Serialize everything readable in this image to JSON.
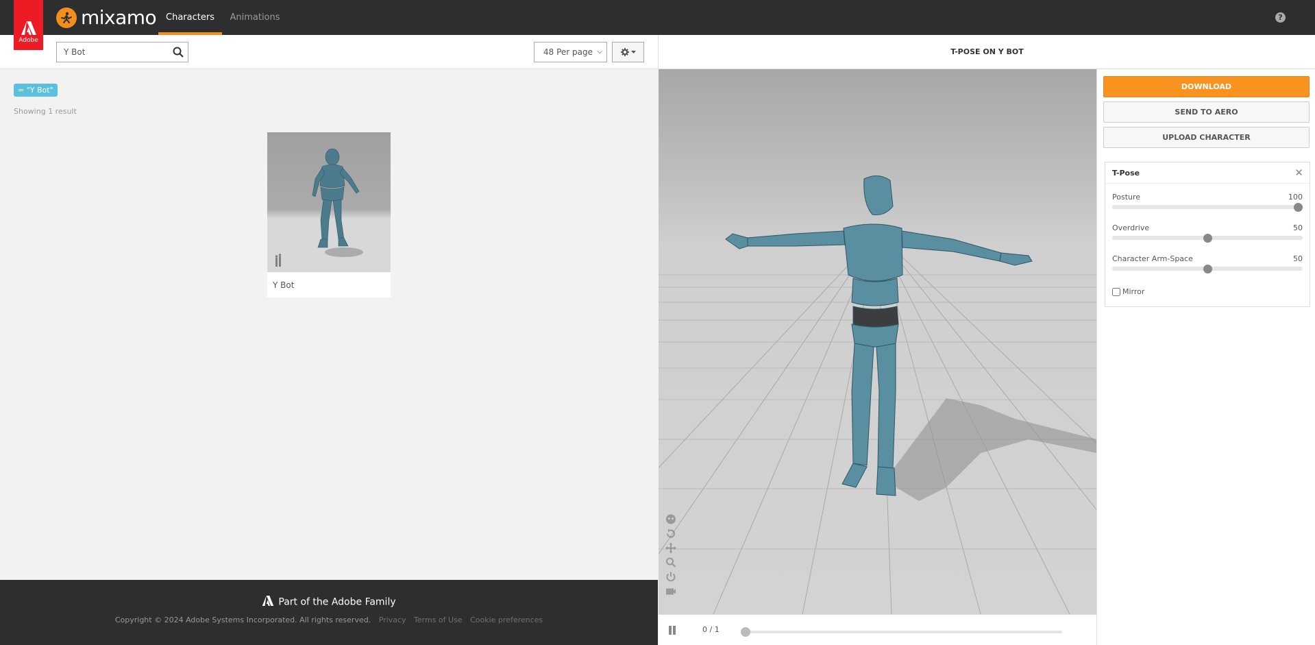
{
  "brand": {
    "adobe_label": "Adobe",
    "app_name": "mixamo",
    "accent": "#f38d1c"
  },
  "nav": {
    "tabs": [
      {
        "label": "Characters",
        "active": true
      },
      {
        "label": "Animations",
        "active": false
      }
    ],
    "help": "?"
  },
  "search": {
    "value": "Y Bot"
  },
  "toolbar": {
    "per_page": "48 Per page"
  },
  "results": {
    "filter_tag": "= \"Y Bot\"",
    "count_text": "Showing 1 result",
    "items": [
      {
        "name": "Y Bot"
      }
    ]
  },
  "footer": {
    "brand": "Part of the Adobe Family",
    "copyright": "Copyright © 2024 Adobe Systems Incorporated. All rights reserved.",
    "links": [
      "Privacy",
      "Terms of Use",
      "Cookie preferences"
    ]
  },
  "viewer": {
    "title": "T-POSE ON Y BOT",
    "frame": "0 / 1",
    "progress": 0
  },
  "actions": {
    "download": "DOWNLOAD",
    "send": "SEND TO AERO",
    "upload": "UPLOAD CHARACTER"
  },
  "panel": {
    "title": "T-Pose",
    "close": "✕",
    "sliders": [
      {
        "label": "Posture",
        "value": "100",
        "fraction": 1.0
      },
      {
        "label": "Overdrive",
        "value": "50",
        "fraction": 0.5
      },
      {
        "label": "Character Arm-Space",
        "value": "50",
        "fraction": 0.5
      }
    ],
    "mirror_label": "Mirror",
    "mirror_checked": false
  }
}
